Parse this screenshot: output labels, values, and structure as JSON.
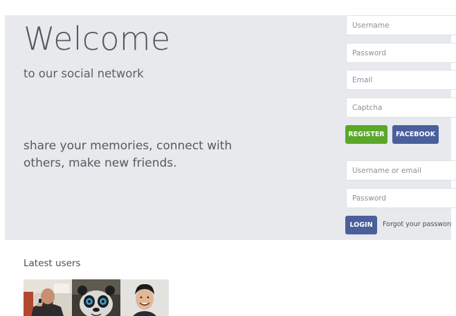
{
  "hero": {
    "title": "Welcome",
    "subtitle": "to our social network",
    "tagline": "share your memories, connect with others, make new friends."
  },
  "register": {
    "username_placeholder": "Username",
    "password_placeholder": "Password",
    "email_placeholder": "Email",
    "captcha_placeholder": "Captcha",
    "register_label": "REGISTER",
    "facebook_label": "FACEBOOK"
  },
  "login": {
    "username_placeholder": "Username or email",
    "password_placeholder": "Password",
    "login_label": "LOGIN",
    "forgot_label": "Forgot your password?"
  },
  "latest_users": {
    "title": "Latest users"
  },
  "colors": {
    "hero_bg": "#e7e9ec",
    "register_green": "#5aa829",
    "facebook_blue": "#4a5f9c"
  }
}
